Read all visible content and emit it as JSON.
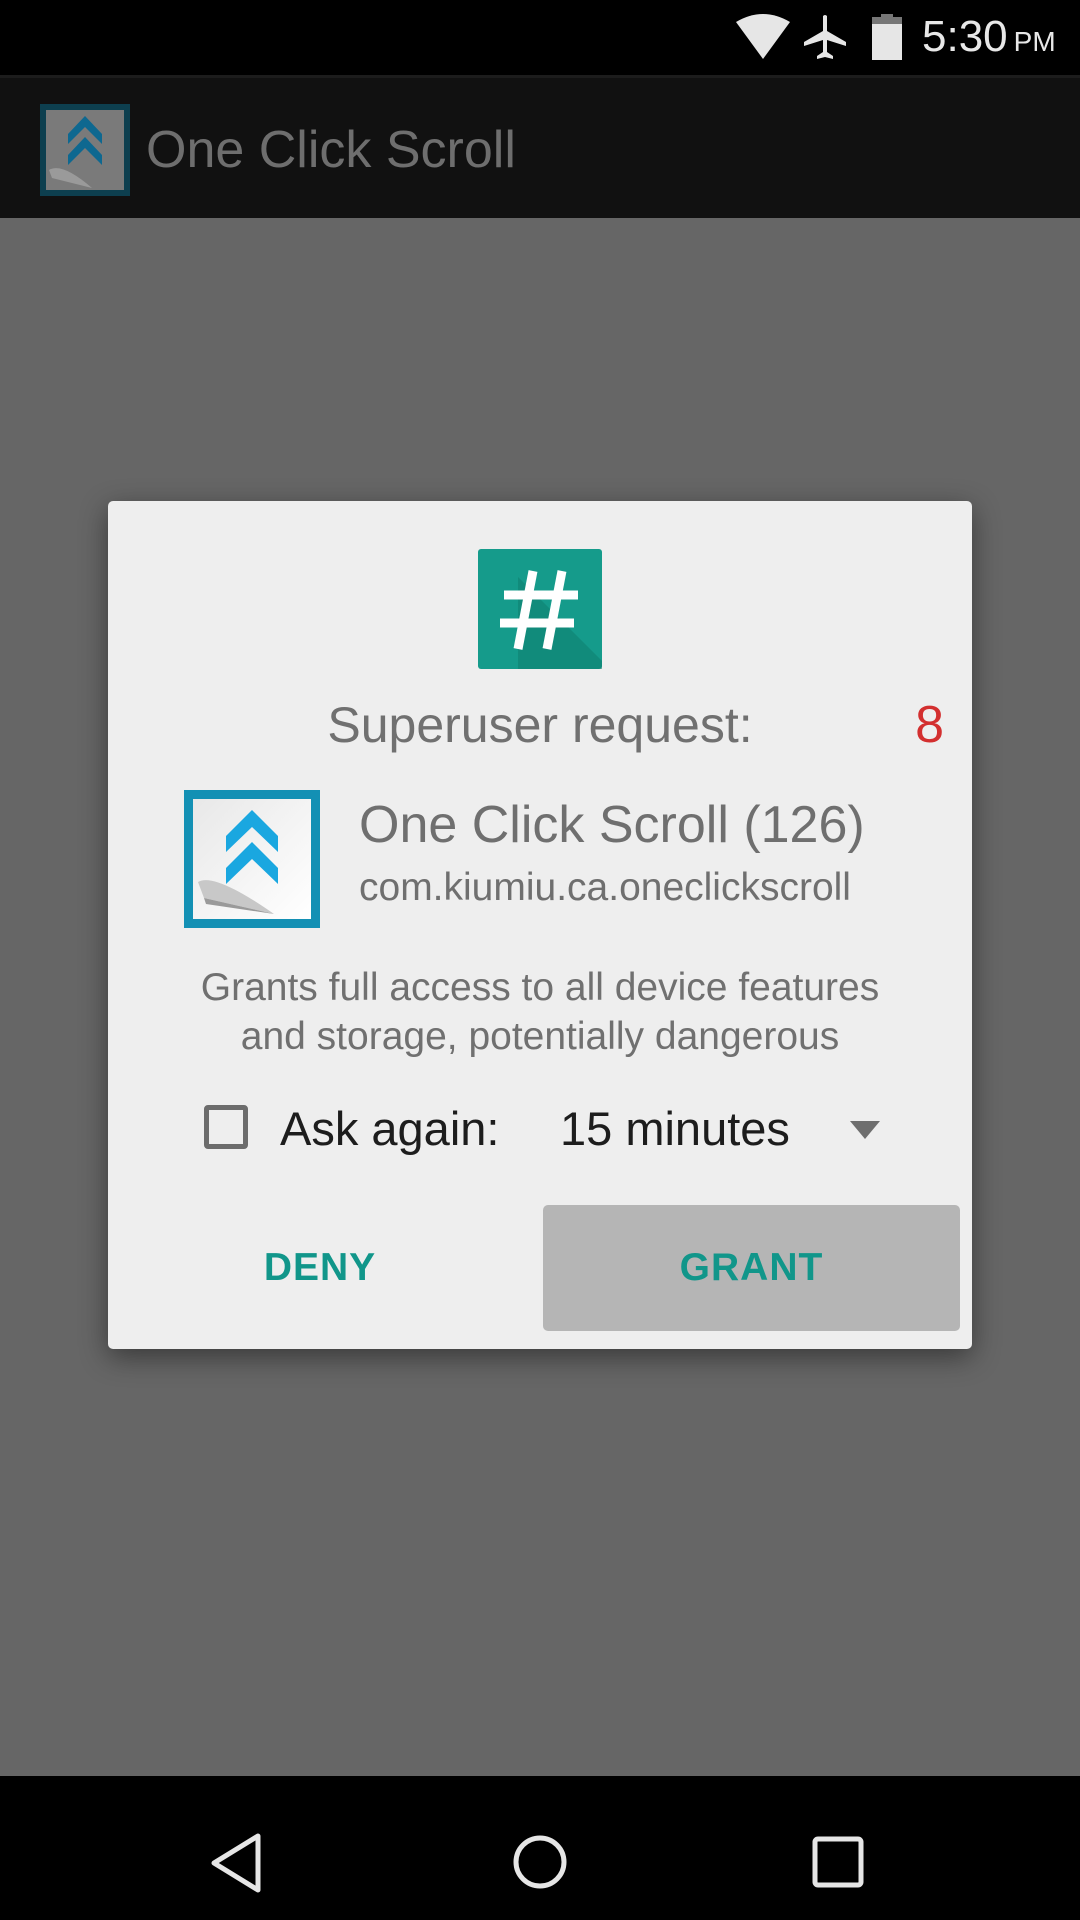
{
  "status_bar": {
    "icons": [
      "wifi-icon",
      "airplane-mode-icon",
      "battery-icon"
    ],
    "time": "5:30",
    "ampm": "PM"
  },
  "app_bar": {
    "icon": "one-click-scroll-app-icon",
    "title": "One Click Scroll"
  },
  "dialog": {
    "header_icon": "superuser-hash-icon",
    "title": "Superuser request:",
    "countdown": "8",
    "request": {
      "app_icon": "one-click-scroll-app-icon",
      "app_name": "One Click Scroll (126)",
      "package": "com.kiumiu.ca.oneclickscroll"
    },
    "description": "Grants full access to all device features and storage, potentially dangerous",
    "ask_again": {
      "label": "Ask again:",
      "checked": false,
      "selected_option": "15 minutes"
    },
    "buttons": {
      "deny": "DENY",
      "grant": "GRANT"
    }
  },
  "nav_bar": {
    "icons": [
      "back-icon",
      "home-icon",
      "recents-icon"
    ]
  },
  "colors": {
    "accent_teal": "#11968a",
    "countdown_red": "#d32f2f",
    "su_icon_teal": "#159b8b",
    "app_icon_blue": "#1aa7e0"
  }
}
